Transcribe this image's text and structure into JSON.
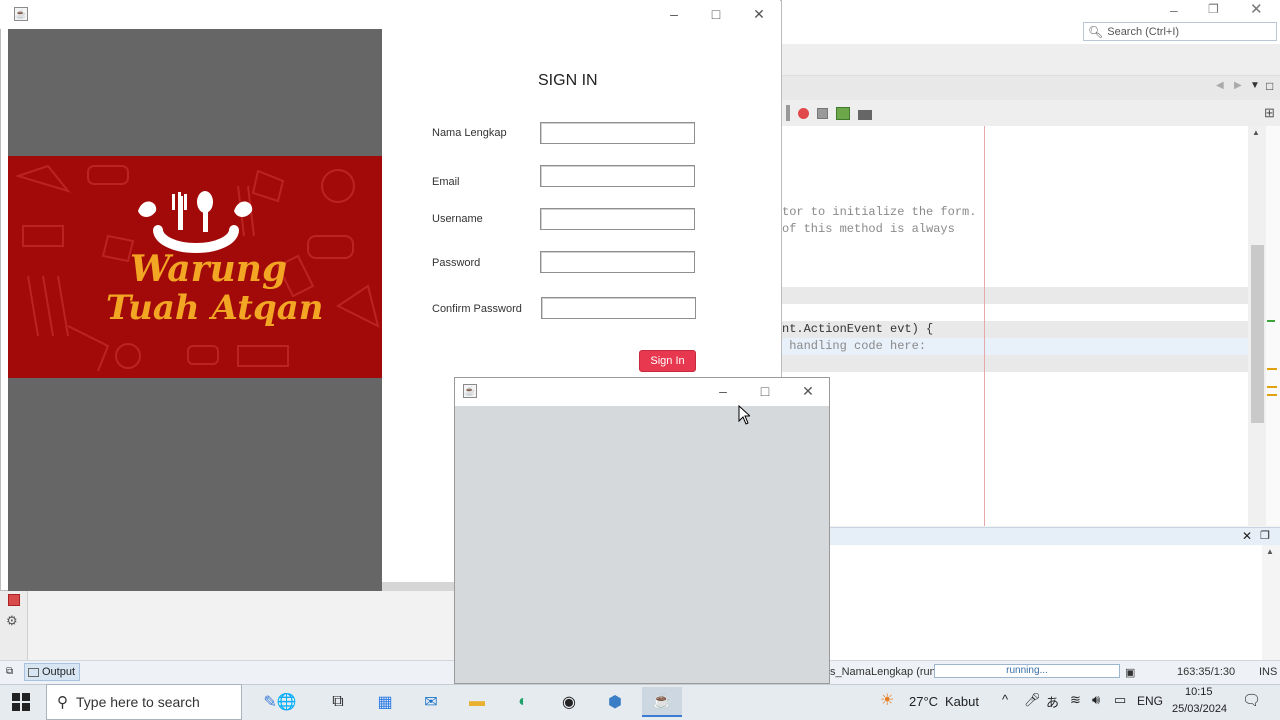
{
  "ide": {
    "search_placeholder": "Search (Ctrl+I)",
    "code_lines": [
      "tor to initialize the form.",
      "of this method is always",
      "nt.ActionEvent evt) {",
      " handling code here:"
    ],
    "output_tab": "Output",
    "status_run": "s_NamaLengkap (run)",
    "status_running": "running...",
    "status_position": "163:35/1:30",
    "status_mode": "INS"
  },
  "signin_window": {
    "title": "SIGN IN",
    "banner_line1": "Warung",
    "banner_line2": "Tuah Atqan",
    "fields": [
      {
        "label": "Nama Lengkap",
        "value": ""
      },
      {
        "label": "Email",
        "value": ""
      },
      {
        "label": "Username",
        "value": ""
      },
      {
        "label": "Password",
        "value": ""
      },
      {
        "label": "Confirm Password",
        "value": ""
      }
    ],
    "button_label": "Sign In"
  },
  "taskbar": {
    "search_placeholder": "Type here to search",
    "weather_temp": "27°C",
    "weather_desc": "Kabut",
    "language": "ENG",
    "time": "10:15",
    "date": "25/03/2024"
  },
  "colors": {
    "banner_red": "#a20a0a",
    "banner_text": "#f2a623",
    "button_red": "#e8384f",
    "image_panel_gray": "#666666"
  }
}
